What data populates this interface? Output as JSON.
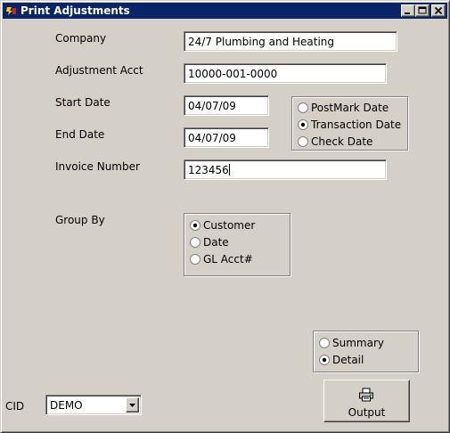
{
  "window": {
    "title": "Print Adjustments",
    "title_bar_color": "#0a246a",
    "background_color": "#d4d0c8"
  },
  "fields": {
    "company": {
      "label": "Company",
      "value": "24/7 Plumbing and Heating"
    },
    "adjustment_acct": {
      "label": "Adjustment Acct",
      "value": "10000-001-0000"
    },
    "start_date": {
      "label": "Start Date",
      "value": "04/07/09"
    },
    "end_date": {
      "label": "End Date",
      "value": "04/07/09"
    },
    "invoice_number": {
      "label": "Invoice Number",
      "value": "123456"
    }
  },
  "date_type": {
    "options": [
      "PostMark Date",
      "Transaction Date",
      "Check Date"
    ],
    "selected": "Transaction Date"
  },
  "group_by": {
    "label": "Group By",
    "options": [
      "Customer",
      "Date",
      "GL Acct#"
    ],
    "selected": "Customer"
  },
  "report_detail": {
    "options": [
      "Summary",
      "Detail"
    ],
    "selected": "Detail"
  },
  "output_button": {
    "label": "Output",
    "icon": "printer-icon"
  },
  "cid": {
    "label": "CID",
    "value": "DEMO"
  }
}
